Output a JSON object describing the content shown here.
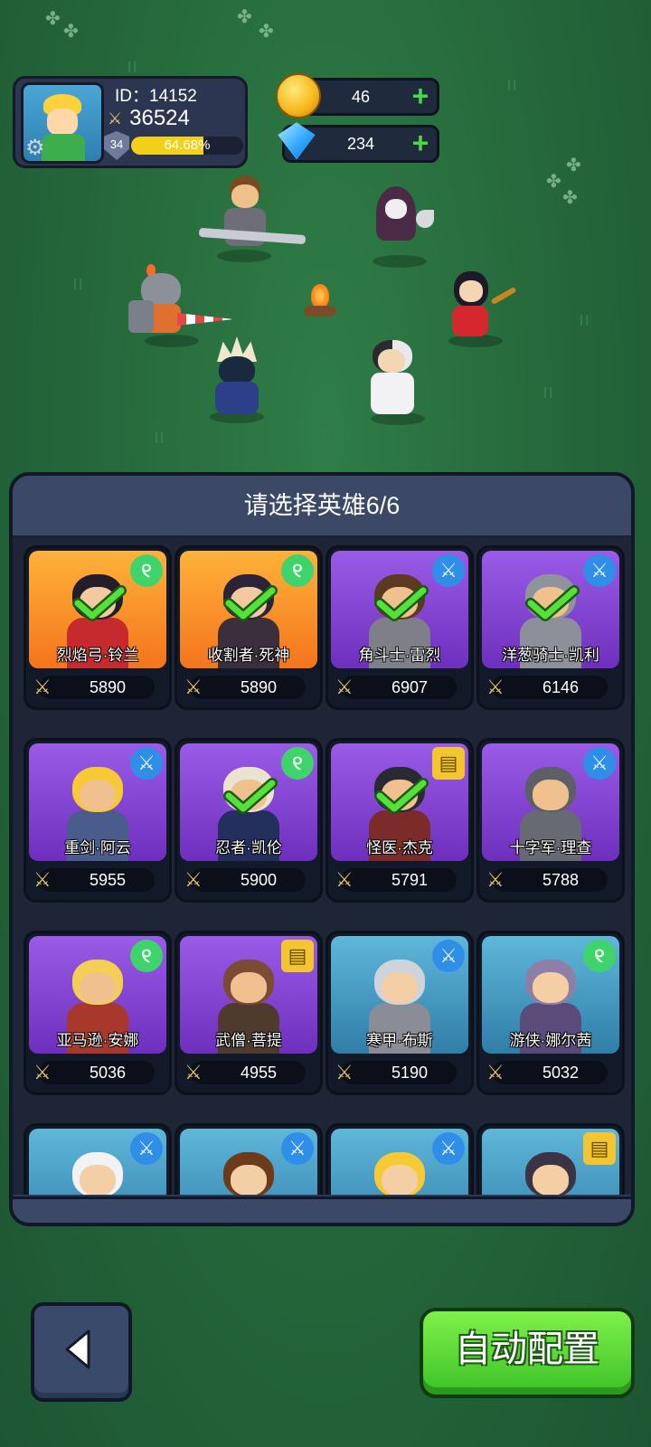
{
  "player": {
    "id_text": "ID：14152",
    "power": "36524",
    "level": "34",
    "exp_percent": "64.68%",
    "exp_fraction": 0.6468
  },
  "currency": {
    "gold": "46",
    "diamonds": "234"
  },
  "selection": {
    "title": "请选择英雄6/6",
    "heroes": [
      {
        "name": "烈焰弓·铃兰",
        "power": "5890",
        "class": "wind-icon",
        "bg": "orange",
        "selected": true
      },
      {
        "name": "收割者·死神",
        "power": "5890",
        "class": "wind-icon",
        "bg": "orange",
        "selected": true
      },
      {
        "name": "角斗士·雷烈",
        "power": "6907",
        "class": "sword-icon",
        "bg": "purple",
        "selected": true
      },
      {
        "name": "洋葱骑士·凯利",
        "power": "6146",
        "class": "sword-icon",
        "bg": "purple",
        "selected": true
      },
      {
        "name": "重剑·阿云",
        "power": "5955",
        "class": "sword-icon",
        "bg": "purple",
        "selected": false
      },
      {
        "name": "忍者·凯伦",
        "power": "5900",
        "class": "wind-icon",
        "bg": "purple",
        "selected": true
      },
      {
        "name": "怪医·杰克",
        "power": "5791",
        "class": "book-icon",
        "bg": "purple",
        "selected": true
      },
      {
        "name": "十字军·理查",
        "power": "5788",
        "class": "sword-icon",
        "bg": "purple",
        "selected": false
      },
      {
        "name": "亚马逊·安娜",
        "power": "5036",
        "class": "wind-icon",
        "bg": "purple",
        "selected": false
      },
      {
        "name": "武僧·菩提",
        "power": "4955",
        "class": "book-icon",
        "bg": "purple",
        "selected": false
      },
      {
        "name": "寒甲·布斯",
        "power": "5190",
        "class": "sword-icon",
        "bg": "blue",
        "selected": false
      },
      {
        "name": "游侠·娜尔茜",
        "power": "5032",
        "class": "wind-icon",
        "bg": "blue",
        "selected": false
      },
      {
        "name": "",
        "power": "",
        "class": "sword-icon",
        "bg": "blue",
        "selected": false
      },
      {
        "name": "",
        "power": "",
        "class": "sword-icon",
        "bg": "blue",
        "selected": false
      },
      {
        "name": "",
        "power": "",
        "class": "sword-icon",
        "bg": "blue",
        "selected": false
      },
      {
        "name": "",
        "power": "",
        "class": "book-icon",
        "bg": "blue",
        "selected": false
      }
    ]
  },
  "buttons": {
    "auto": "自动配置"
  },
  "colors": {
    "accent_green": "#3cc227",
    "panel": "#2c3854",
    "wind": "#3ed46b",
    "sword": "#2f8ee8",
    "book": "#f3c630"
  }
}
